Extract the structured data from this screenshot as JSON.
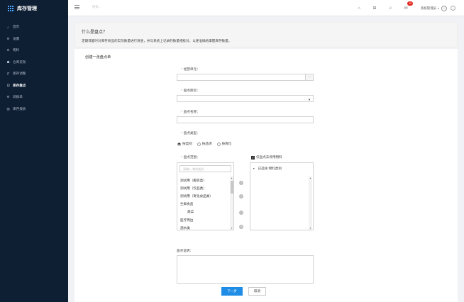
{
  "app": {
    "title": "库存管理"
  },
  "sidebar": {
    "items": [
      {
        "label": "首页",
        "icon": "home-icon",
        "glyph": "⌂"
      },
      {
        "label": "设置",
        "icon": "gear-icon",
        "glyph": "⚙"
      },
      {
        "label": "物料",
        "icon": "material-icon",
        "glyph": "⚙"
      },
      {
        "label": "仓库货架",
        "icon": "warehouse-icon",
        "glyph": "☗"
      },
      {
        "label": "库存调整",
        "icon": "adjust-icon",
        "glyph": "⇄"
      },
      {
        "label": "库存盘点",
        "icon": "inventory-check-icon",
        "glyph": "☑",
        "active": true
      },
      {
        "label": "调拨单",
        "icon": "transfer-icon",
        "glyph": "⚙"
      },
      {
        "label": "库存报表",
        "icon": "report-icon",
        "glyph": "▥"
      }
    ]
  },
  "topbar": {
    "search_placeholder": "搜索...",
    "badge_count": "10",
    "user_name": "系统管理员"
  },
  "banner": {
    "question": "什么是盘点？",
    "description": "定期或临时对库存商品的实际数量进行清查，并与系统上记录的数量相核对，以便准确地掌握库存数量。"
  },
  "form": {
    "title": "创建一张盘点单",
    "business_unit_label": "经营单元：",
    "warehouse_label": "盘点库房：",
    "name_label": "盘点名称：",
    "type_label": "盘点类型：",
    "type_options": [
      "按类别",
      "按品牌",
      "按库位"
    ],
    "type_selected": 0,
    "scope_label": "盘点范围：",
    "only_disabled_label": "仅盘点未停用物料",
    "filter_placeholder": "请输入 物料类别",
    "categories": [
      {
        "label": "测试用（服装类）",
        "indent": false
      },
      {
        "label": "测试用（饮品类）",
        "indent": false
      },
      {
        "label": "测试用（寄化食品类）",
        "indent": false
      },
      {
        "label": "生鲜食品",
        "indent": false
      },
      {
        "label": "蔬菜",
        "indent": true
      },
      {
        "label": "医疗周边",
        "indent": false
      },
      {
        "label": "酒水类",
        "indent": false
      }
    ],
    "selected_header": "已选择 物料类别",
    "description_label": "盘点说明：",
    "next_button": "下一步",
    "cancel_button": "取消"
  }
}
